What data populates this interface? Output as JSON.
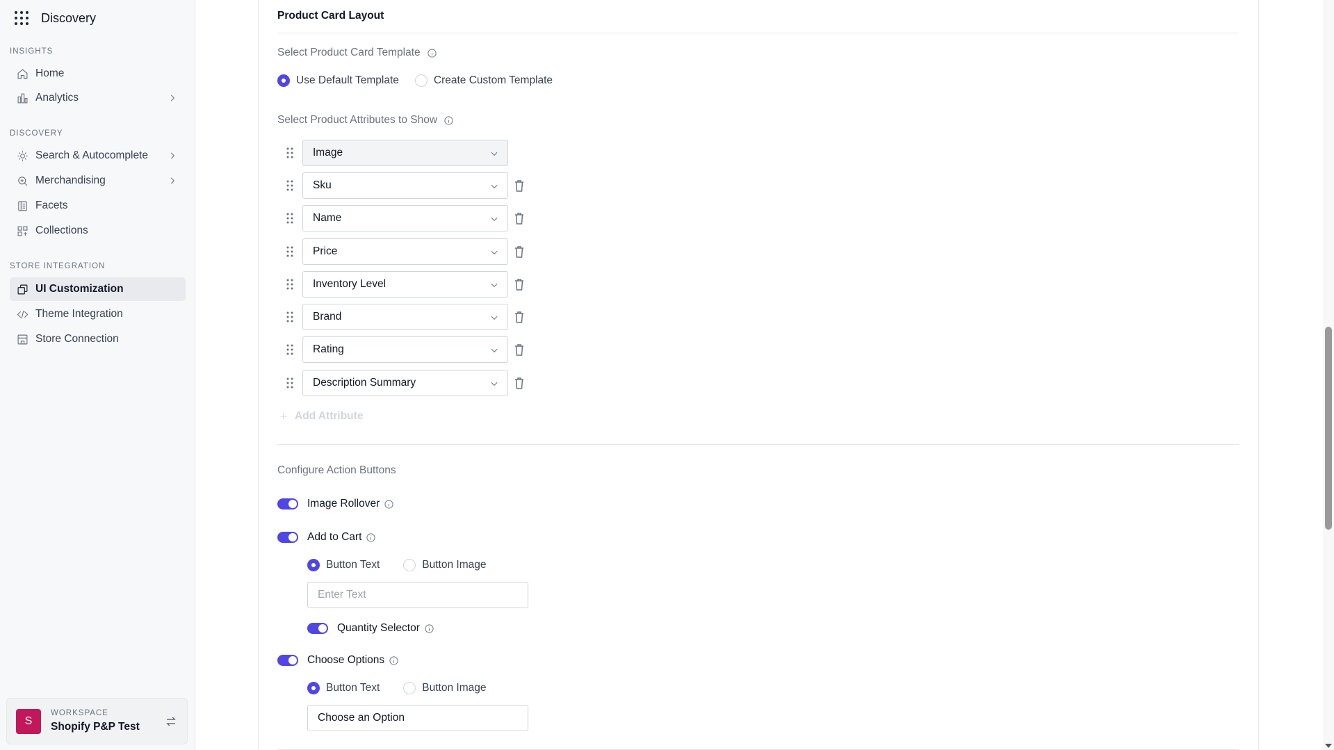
{
  "app": {
    "name": "Discovery"
  },
  "sidebar": {
    "sections": [
      {
        "label": "INSIGHTS"
      },
      {
        "label": "DISCOVERY"
      },
      {
        "label": "STORE INTEGRATION"
      }
    ],
    "items": [
      {
        "label": "Home",
        "icon": "home-icon"
      },
      {
        "label": "Analytics",
        "icon": "analytics-icon"
      },
      {
        "label": "Search & Autocomplete",
        "icon": "search-autocomplete-icon"
      },
      {
        "label": "Merchandising",
        "icon": "merchandising-icon"
      },
      {
        "label": "Facets",
        "icon": "facets-icon"
      },
      {
        "label": "Collections",
        "icon": "collections-icon"
      },
      {
        "label": "UI Customization",
        "icon": "ui-customization-icon",
        "active": true
      },
      {
        "label": "Theme Integration",
        "icon": "code-icon"
      },
      {
        "label": "Store Connection",
        "icon": "store-icon"
      }
    ],
    "workspace": {
      "label": "WORKSPACE",
      "name": "Shopify P&P Test",
      "avatar": "S",
      "avatar_color": "#c2185b"
    }
  },
  "main": {
    "section_title": "Product Card Layout",
    "template": {
      "label": "Select Product Card Template",
      "options": [
        "Use Default Template",
        "Create Custom Template"
      ],
      "selected": "Use Default Template"
    },
    "attributes": {
      "label": "Select Product Attributes to Show",
      "items": [
        "Image",
        "Sku",
        "Name",
        "Price",
        "Inventory Level",
        "Brand",
        "Rating",
        "Description Summary"
      ],
      "add_label": "Add Attribute"
    },
    "actions": {
      "label": "Configure Action Buttons",
      "image_rollover": {
        "label": "Image Rollover",
        "enabled": true
      },
      "add_to_cart": {
        "label": "Add to Cart",
        "enabled": true,
        "options": [
          "Button Text",
          "Button Image"
        ],
        "selected": "Button Text",
        "text_placeholder": "Enter Text",
        "quantity_selector": {
          "label": "Quantity Selector",
          "enabled": true
        }
      },
      "choose_options": {
        "label": "Choose Options",
        "enabled": true,
        "options": [
          "Button Text",
          "Button Image"
        ],
        "selected": "Button Text",
        "text_value": "Choose an Option"
      }
    }
  },
  "colors": {
    "accent": "#4f46e5",
    "avatar": "#c2185b"
  }
}
